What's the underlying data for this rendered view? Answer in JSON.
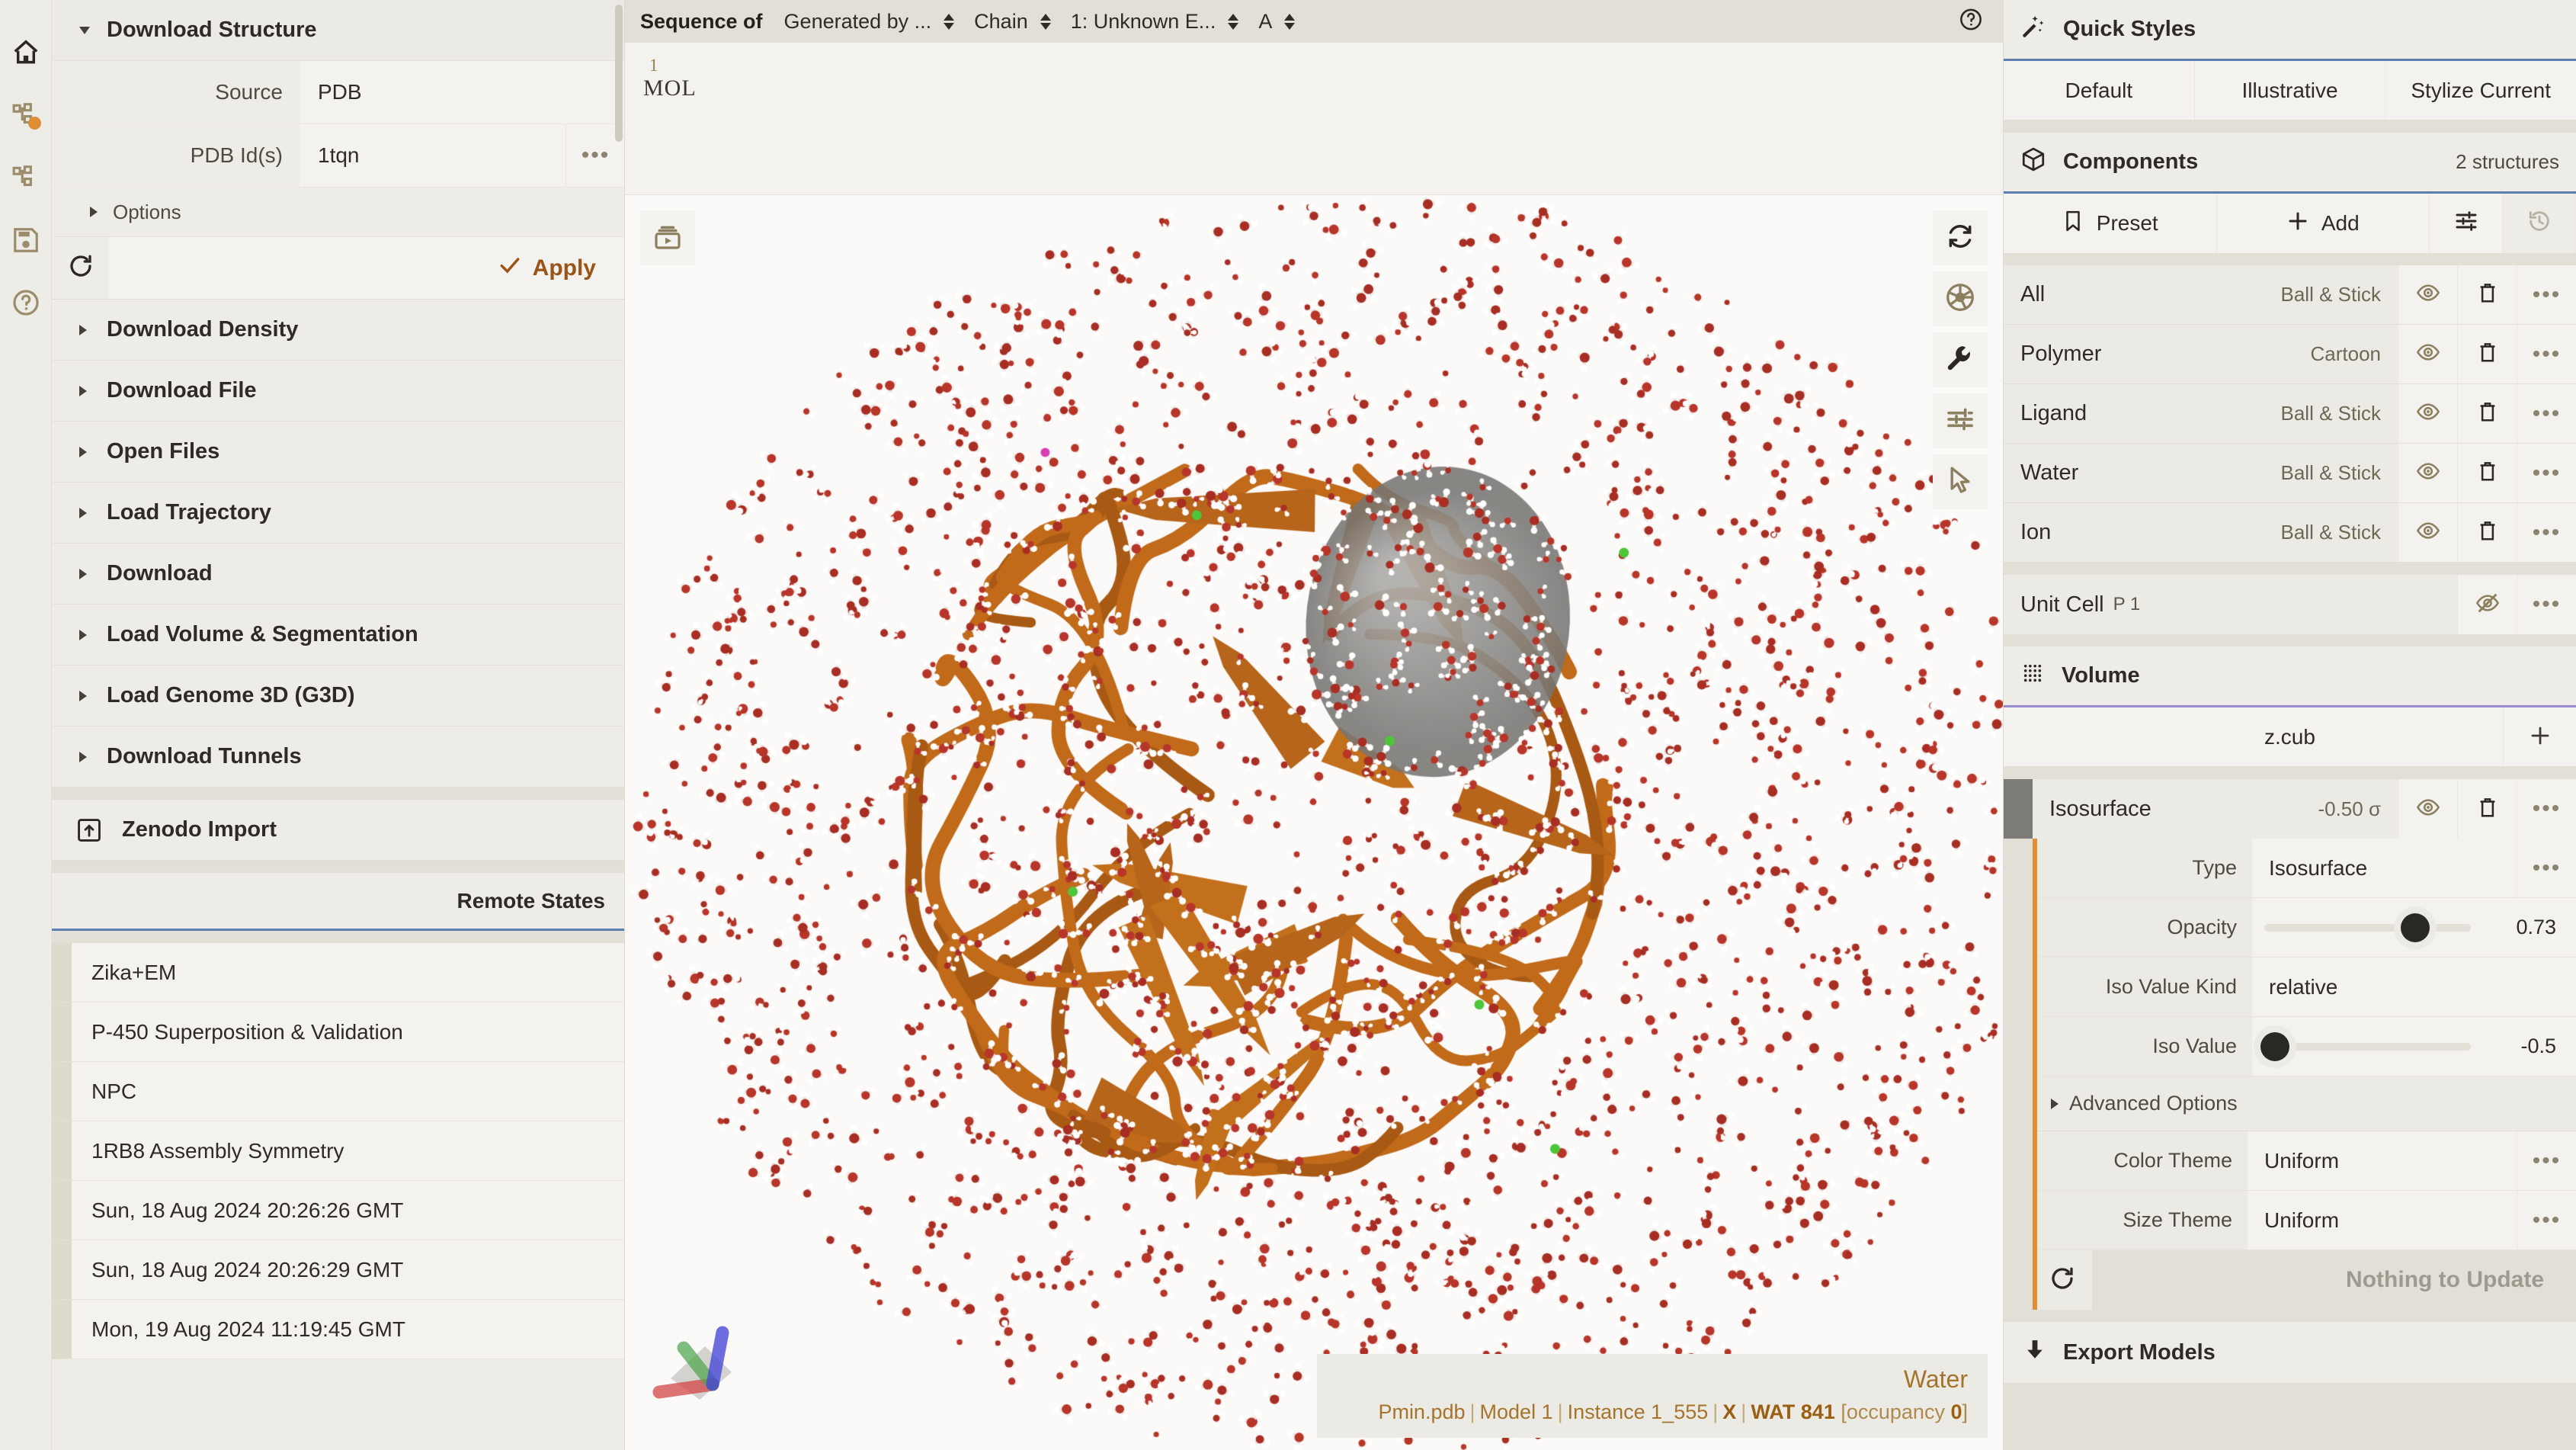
{
  "rail": {
    "items": [
      {
        "icon": "home-icon",
        "name": "home"
      },
      {
        "icon": "structure-tree-icon",
        "name": "data",
        "badge": true
      },
      {
        "icon": "state-tree-icon",
        "name": "state"
      },
      {
        "icon": "save-disk-icon",
        "name": "save"
      },
      {
        "icon": "help-circle-icon",
        "name": "help"
      }
    ]
  },
  "left_panel": {
    "download_structure": {
      "title": "Download Structure",
      "expanded": true,
      "rows": [
        {
          "label": "Source",
          "value": "PDB",
          "more": false
        },
        {
          "label": "PDB Id(s)",
          "value": "1tqn",
          "more": true
        }
      ],
      "options_label": "Options",
      "apply_label": "Apply",
      "refresh_icon": "refresh-icon"
    },
    "sections": [
      {
        "label": "Download Density"
      },
      {
        "label": "Download File"
      },
      {
        "label": "Open Files"
      },
      {
        "label": "Load Trajectory"
      },
      {
        "label": "Download"
      },
      {
        "label": "Load Volume & Segmentation"
      },
      {
        "label": "Load Genome 3D (G3D)"
      },
      {
        "label": "Download Tunnels"
      }
    ],
    "zenodo": {
      "label": "Zenodo Import",
      "icon": "import-box-icon"
    },
    "remote_states": {
      "title": "Remote States",
      "items": [
        "Zika+EM",
        "P-450 Superposition & Validation",
        "NPC",
        "1RB8 Assembly Symmetry",
        "Sun, 18 Aug 2024 20:26:26 GMT",
        "Sun, 18 Aug 2024 20:26:29 GMT",
        "Mon, 19 Aug 2024 11:19:45 GMT"
      ]
    }
  },
  "sequence": {
    "label": "Sequence of",
    "selects": [
      {
        "value": "Generated by ...",
        "name": "structure-select"
      },
      {
        "value": "Chain",
        "name": "entity-kind-select"
      },
      {
        "value": "1: Unknown E...",
        "name": "entity-select"
      },
      {
        "value": "A",
        "name": "chain-select"
      }
    ],
    "help_icon": "help-circle-icon",
    "residue_number": "1",
    "residue_code": "MOL"
  },
  "viewport": {
    "animation_icon": "animation-play-icon",
    "tools": [
      {
        "icon": "reset-camera-icon",
        "name": "reset-camera"
      },
      {
        "icon": "screenshot-aperture-icon",
        "name": "screenshot"
      },
      {
        "icon": "wrench-icon",
        "name": "tools"
      },
      {
        "icon": "sliders-icon",
        "name": "settings"
      },
      {
        "icon": "cursor-arrow-icon",
        "name": "selection-mode"
      }
    ],
    "axes": {
      "x_color": "#d04040",
      "y_color": "#4ea64e",
      "z_color": "#4646d8"
    },
    "status": {
      "title": "Water",
      "file": "Pmin.pdb",
      "model": "Model 1",
      "instance": "Instance 1_555",
      "chain": "X",
      "residue": "WAT 841",
      "occupancy_label": "[occupancy ",
      "occupancy_value": "0",
      "occupancy_close": "]"
    }
  },
  "right_panel": {
    "quick_styles": {
      "title": "Quick Styles",
      "icon": "magic-wand-icon",
      "buttons": [
        "Default",
        "Illustrative",
        "Stylize Current"
      ]
    },
    "components": {
      "title": "Components",
      "icon": "cube-icon",
      "count": "2 structures",
      "controls": [
        {
          "label": "Preset",
          "icon": "bookmark-icon"
        },
        {
          "label": "Add",
          "icon": "plus-icon"
        },
        {
          "label": "",
          "icon": "options-sliders-icon"
        },
        {
          "label": "",
          "icon": "history-icon"
        }
      ],
      "rows": [
        {
          "name": "All",
          "repr": "Ball & Stick",
          "visible": true
        },
        {
          "name": "Polymer",
          "repr": "Cartoon",
          "visible": true
        },
        {
          "name": "Ligand",
          "repr": "Ball & Stick",
          "visible": true
        },
        {
          "name": "Water",
          "repr": "Ball & Stick",
          "visible": true
        },
        {
          "name": "Ion",
          "repr": "Ball & Stick",
          "visible": true
        }
      ],
      "unit_cell": {
        "name": "Unit Cell",
        "sub": "P 1",
        "visible": false
      }
    },
    "volume": {
      "title": "Volume",
      "icon": "volume-grid-icon",
      "file": "z.cub",
      "add_icon": "plus-icon",
      "isosurface_row": {
        "name": "Isosurface",
        "value": "-0.50 σ",
        "swatch": "#7d7b78",
        "visible": true
      },
      "params": [
        {
          "label": "Type",
          "value": "Isosurface",
          "kind": "select"
        },
        {
          "label": "Opacity",
          "value": "0.73",
          "kind": "slider",
          "pct": 73
        },
        {
          "label": "Iso Value Kind",
          "value": "relative",
          "kind": "text"
        },
        {
          "label": "Iso Value",
          "value": "-0.5",
          "kind": "slider",
          "pct": 5
        }
      ],
      "advanced_label": "Advanced Options",
      "themes": [
        {
          "label": "Color Theme",
          "value": "Uniform"
        },
        {
          "label": "Size Theme",
          "value": "Uniform"
        }
      ],
      "update_label": "Nothing to Update",
      "refresh_icon": "refresh-icon"
    },
    "export": {
      "title": "Export Models",
      "icon": "download-arrow-icon"
    }
  }
}
